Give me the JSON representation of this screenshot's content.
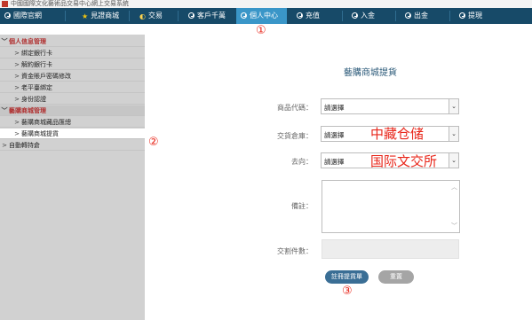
{
  "window": {
    "title": "中國國際文化藝術品交易中心網上交易系統"
  },
  "nav": {
    "items": [
      {
        "label": "國際官網",
        "icon": "globe-icon",
        "active": false
      },
      {
        "label": "見證商城",
        "icon": "star-icon",
        "active": false
      },
      {
        "label": "交易",
        "icon": "trade-icon",
        "active": false
      },
      {
        "label": "客戶千萬",
        "icon": "globe-icon",
        "active": false
      },
      {
        "label": "個人中心",
        "icon": "globe-icon",
        "active": true
      },
      {
        "label": "充值",
        "icon": "globe-icon",
        "active": false
      },
      {
        "label": "入金",
        "icon": "globe-icon",
        "active": false
      },
      {
        "label": "出金",
        "icon": "globe-icon",
        "active": false
      },
      {
        "label": "提現",
        "icon": "globe-icon",
        "active": false
      }
    ]
  },
  "annotations": {
    "one": "①",
    "two": "②",
    "three": "③",
    "warehouse_note": "中藏仓储",
    "destination_note": "国际文交所"
  },
  "sidebar": {
    "items": [
      {
        "mark": "﹀",
        "label": "個人信息管理",
        "type": "group"
      },
      {
        "mark": ">",
        "label": "綁定銀行卡",
        "type": "item"
      },
      {
        "mark": ">",
        "label": "解約銀行卡",
        "type": "item"
      },
      {
        "mark": ">",
        "label": "資金賬戶密碼修改",
        "type": "item"
      },
      {
        "mark": ">",
        "label": "老平臺綁定",
        "type": "item"
      },
      {
        "mark": ">",
        "label": "身份認證",
        "type": "item"
      },
      {
        "mark": "﹀",
        "label": "藝購商城管理",
        "type": "group2"
      },
      {
        "mark": ">",
        "label": "藝購商城藏品匯總",
        "type": "item"
      },
      {
        "mark": ">",
        "label": "藝購商城提貨",
        "type": "active"
      },
      {
        "mark": ">",
        "label": "自動轉持倉",
        "type": "item"
      }
    ]
  },
  "form": {
    "title": "藝購商城提貨",
    "product_code": {
      "label": "商品代碼：",
      "value": "請選擇"
    },
    "warehouse": {
      "label": "交貨倉庫：",
      "value": "請選擇"
    },
    "destination": {
      "label": "去向：",
      "value": "請選擇"
    },
    "remark": {
      "label": "備註：",
      "value": ""
    },
    "count": {
      "label": "交割件數：",
      "value": ""
    },
    "submit_label": "註冊提貨單",
    "reset_label": "重置"
  },
  "colors": {
    "nav": "#174a68",
    "nav_active": "#3a96c8",
    "sidebar": "#d1d1d1",
    "annotation": "#e8261a"
  }
}
